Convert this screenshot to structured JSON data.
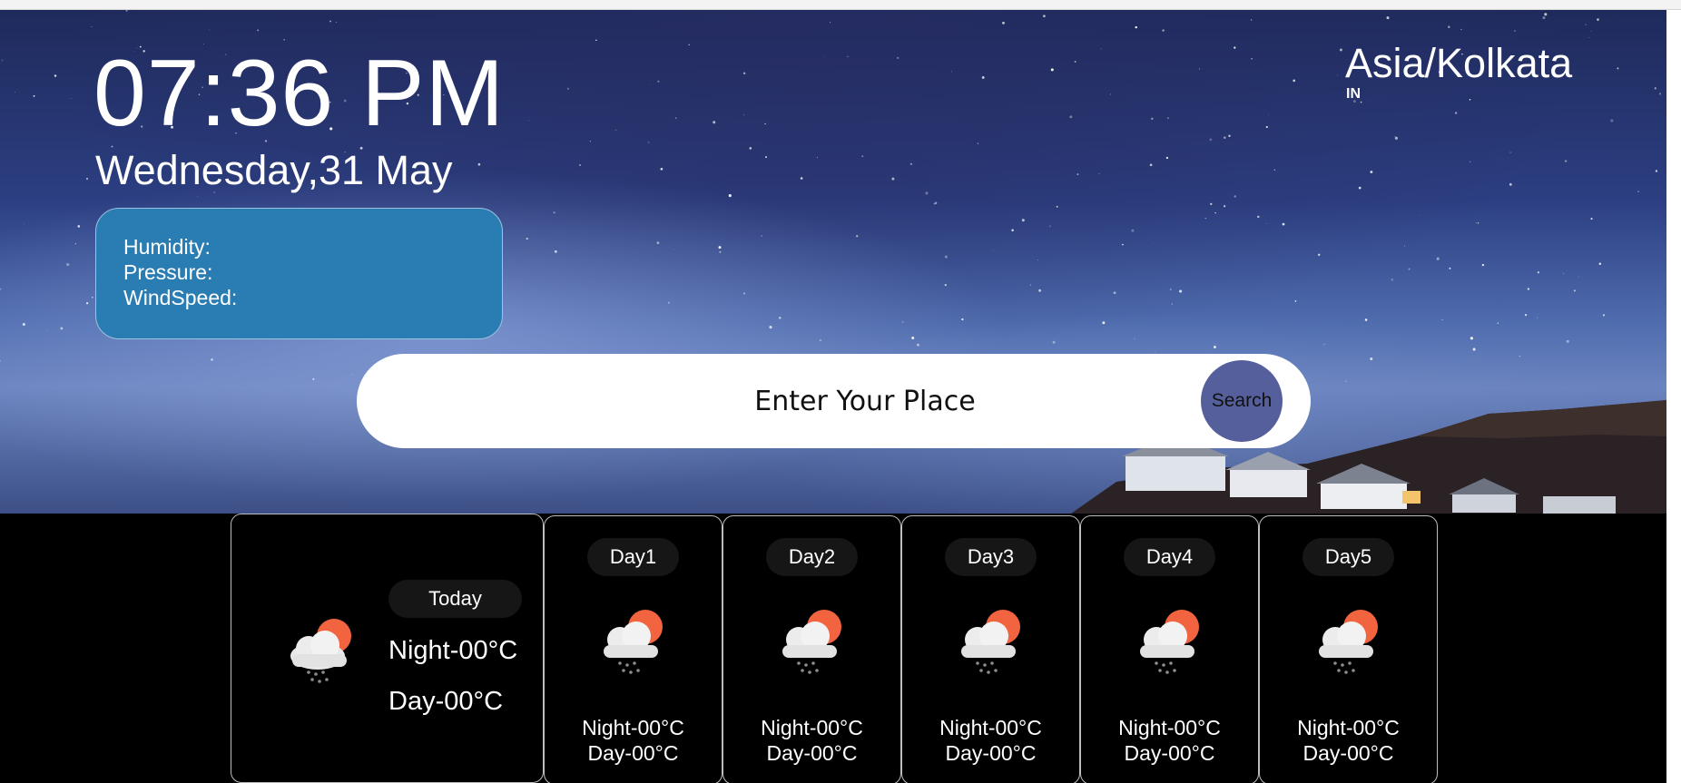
{
  "clock": {
    "time": "07:36 PM",
    "date": "Wednesday,31 May"
  },
  "location": {
    "timezone": "Asia/Kolkata",
    "country": "IN"
  },
  "stats": [
    {
      "label": "Humidity:",
      "value": ""
    },
    {
      "label": "Pressure:",
      "value": ""
    },
    {
      "label": "WindSpeed:",
      "value": ""
    }
  ],
  "search": {
    "placeholder": "Enter Your Place",
    "button_label": "Search"
  },
  "today": {
    "label": "Today",
    "night": "Night-00°C",
    "day": "Day-00°C",
    "icon": "cloud-rain-sun-icon"
  },
  "forecast": [
    {
      "label": "Day1",
      "night": "Night-00°C",
      "day": "Day-00°C",
      "icon": "cloud-rain-sun-icon"
    },
    {
      "label": "Day2",
      "night": "Night-00°C",
      "day": "Day-00°C",
      "icon": "cloud-rain-sun-icon"
    },
    {
      "label": "Day3",
      "night": "Night-00°C",
      "day": "Day-00°C",
      "icon": "cloud-rain-sun-icon"
    },
    {
      "label": "Day4",
      "night": "Night-00°C",
      "day": "Day-00°C",
      "icon": "cloud-rain-sun-icon"
    },
    {
      "label": "Day5",
      "night": "Night-00°C",
      "day": "Day-00°C",
      "icon": "cloud-rain-sun-icon"
    }
  ],
  "colors": {
    "stats_card": "#2a7db3",
    "search_button": "#555f9c",
    "sun": "#f2643f",
    "cloud": "#e8e8e8",
    "forecast_background": "#000000",
    "pill_background": "#161616"
  }
}
